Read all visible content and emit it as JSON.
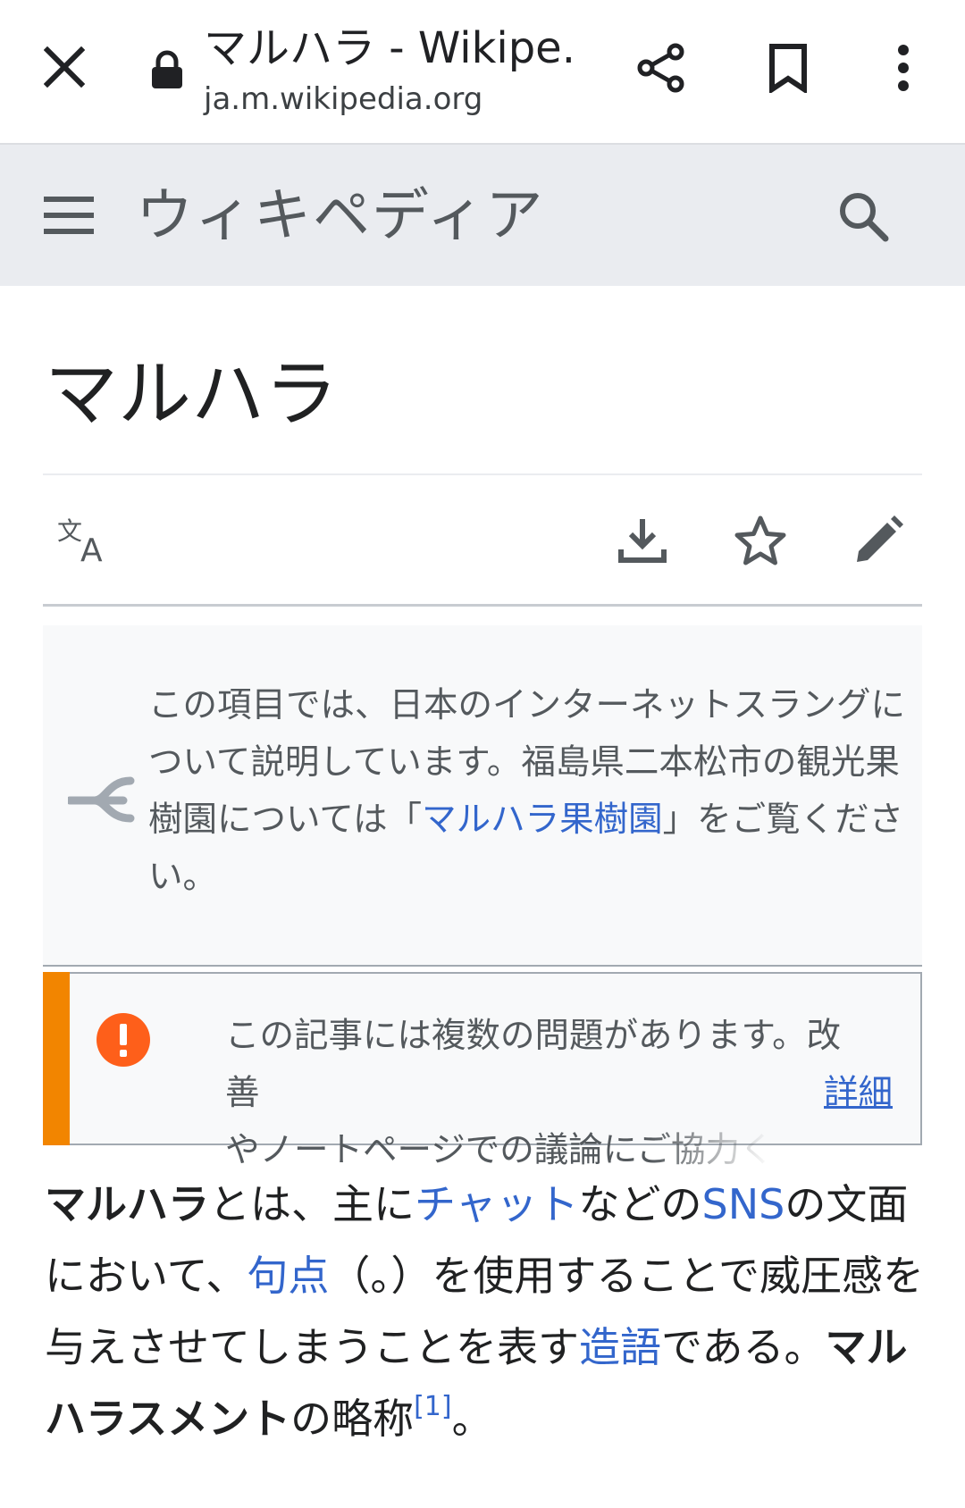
{
  "browser": {
    "title": "マルハラ - Wikipe...",
    "host": "ja.m.wikipedia.org",
    "icons": [
      "close-icon",
      "lock-icon",
      "share-icon",
      "bookmark-icon",
      "more-vert-icon"
    ]
  },
  "header": {
    "wordmark": "ウィキペディア",
    "icons": [
      "menu-icon",
      "search-icon"
    ]
  },
  "page": {
    "title": "マルハラ"
  },
  "actions": {
    "icons": [
      "language-icon",
      "download-icon",
      "star-icon",
      "edit-icon"
    ]
  },
  "hatnote": {
    "text_before": "この項目では、日本のインターネットスラングについて説明しています。福島県二本松市の観光果樹園については「",
    "link": "マルハラ果樹園",
    "text_after": "」をご覧ください。"
  },
  "ambox": {
    "line1": "この記事には複数の問題があります。改善",
    "line2": "やノートページでの議論にご協力ください。",
    "more": "詳細",
    "accent_color": "#f28500",
    "icon_color": "#fe5f1a"
  },
  "lead": {
    "term": "マルハラ",
    "t1": "とは、主に",
    "link_chat": "チャット",
    "t2": "などの",
    "link_sns": "SNS",
    "t3": "の文面において、",
    "link_kuten": "句点",
    "t4": "（。）を使用することで威圧感を与えさせてしまうことを表す",
    "link_zougo": "造語",
    "t5": "である。",
    "term2": "マルハラスメント",
    "t6": "の略称",
    "ref": "[1]",
    "t7": "。"
  },
  "colors": {
    "link": "#3366cc",
    "header_bg": "#eaecf0",
    "hatnote_bg": "#f8f9fa"
  }
}
